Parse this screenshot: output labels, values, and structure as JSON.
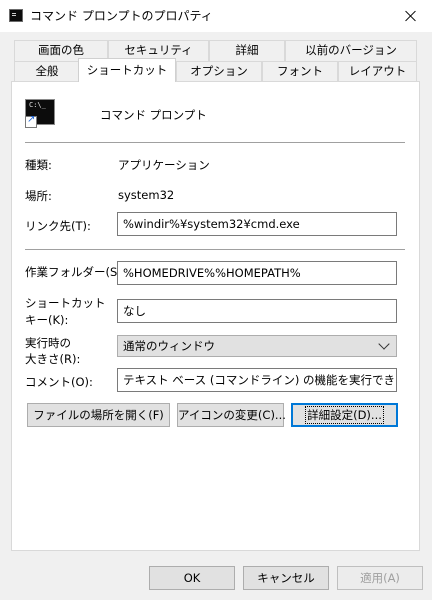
{
  "window": {
    "title": "コマンド プロンプトのプロパティ"
  },
  "tabs_row1": [
    "画面の色",
    "セキュリティ",
    "詳細",
    "以前のバージョン"
  ],
  "tabs_row2": [
    "全般",
    "ショートカット",
    "オプション",
    "フォント",
    "レイアウト"
  ],
  "active_tab": "ショートカット",
  "shortcut": {
    "name": "コマンド プロンプト",
    "type_label": "種類:",
    "type_value": "アプリケーション",
    "location_label": "場所:",
    "location_value": "system32",
    "target_label": "リンク先(T):",
    "target_value": "%windir%¥system32¥cmd.exe",
    "startin_label": "作業フォルダー(S):",
    "startin_value": "%HOMEDRIVE%%HOMEPATH%",
    "hotkey_label_line1": "ショートカット",
    "hotkey_label_line2": "キー(K):",
    "hotkey_value": "なし",
    "run_label_line1": "実行時の",
    "run_label_line2": "大きさ(R):",
    "run_value": "通常のウィンドウ",
    "comment_label": "コメント(O):",
    "comment_value": "テキスト ベース (コマンドライン) の機能を実行できます。"
  },
  "buttons": {
    "open_location": "ファイルの場所を開く(F)",
    "change_icon": "アイコンの変更(C)...",
    "advanced": "詳細設定(D)..."
  },
  "footer": {
    "ok": "OK",
    "cancel": "キャンセル",
    "apply": "適用(A)"
  }
}
